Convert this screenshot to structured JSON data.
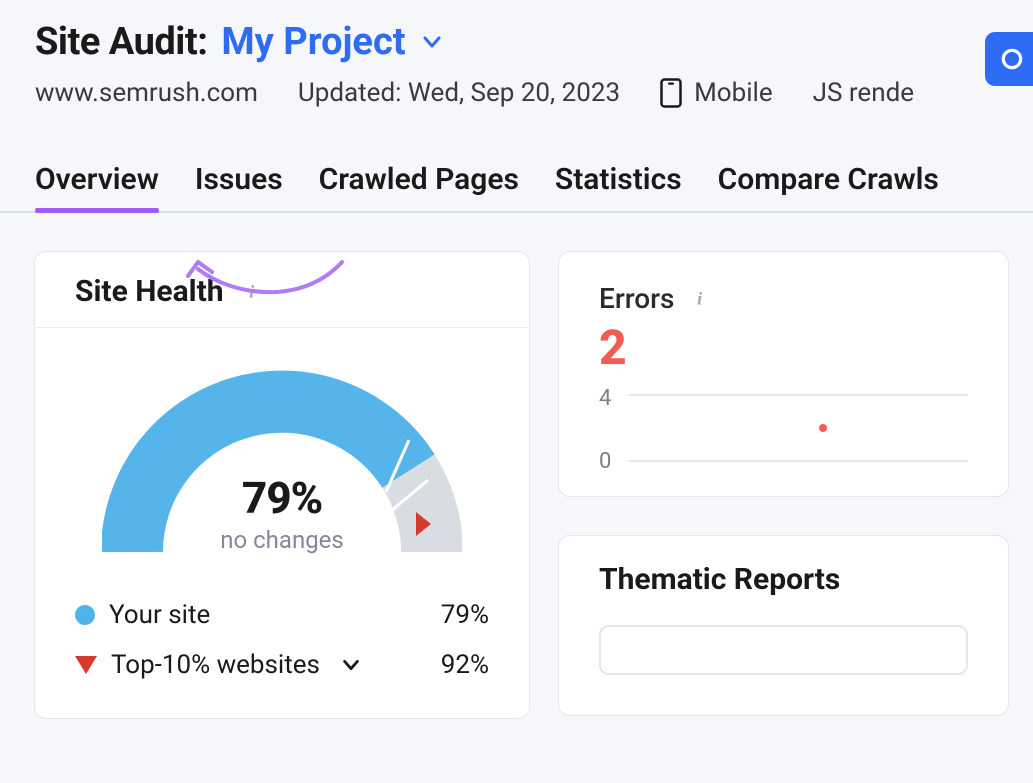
{
  "header": {
    "title_prefix": "Site Audit:",
    "project_name": "My Project",
    "domain": "www.semrush.com",
    "updated": "Updated: Wed, Sep 20, 2023",
    "device": "Mobile",
    "js_rendering": "JS rende"
  },
  "tabs": [
    "Overview",
    "Issues",
    "Crawled Pages",
    "Statistics",
    "Compare Crawls"
  ],
  "site_health": {
    "title": "Site Health",
    "percent_label": "79%",
    "sub_label": "no changes",
    "legend": {
      "your_site_label": "Your site",
      "your_site_value": "79%",
      "top10_label": "Top-10% websites",
      "top10_value": "92%"
    }
  },
  "errors": {
    "title": "Errors",
    "value": "2",
    "y_ticks": [
      "4",
      "0"
    ]
  },
  "thematic": {
    "title": "Thematic Reports"
  },
  "colors": {
    "accent_purple": "#a15cfc",
    "accent_blue": "#2e6cf6",
    "gauge_blue": "#55b4ea",
    "gauge_gray": "#d9dde3",
    "error_red": "#f25c54",
    "marker_red": "#d63a2e"
  },
  "chart_data": [
    {
      "type": "pie",
      "title": "Site Health",
      "series": [
        {
          "name": "Your site",
          "values": [
            79
          ]
        },
        {
          "name": "Top-10% websites",
          "values": [
            92
          ]
        }
      ],
      "value_label": "79%",
      "value_sublabel": "no changes",
      "ylim": [
        0,
        100
      ]
    },
    {
      "type": "line",
      "title": "Errors",
      "x": [
        0
      ],
      "values": [
        2
      ],
      "ylim": [
        0,
        4
      ],
      "y_ticks": [
        0,
        4
      ]
    }
  ]
}
